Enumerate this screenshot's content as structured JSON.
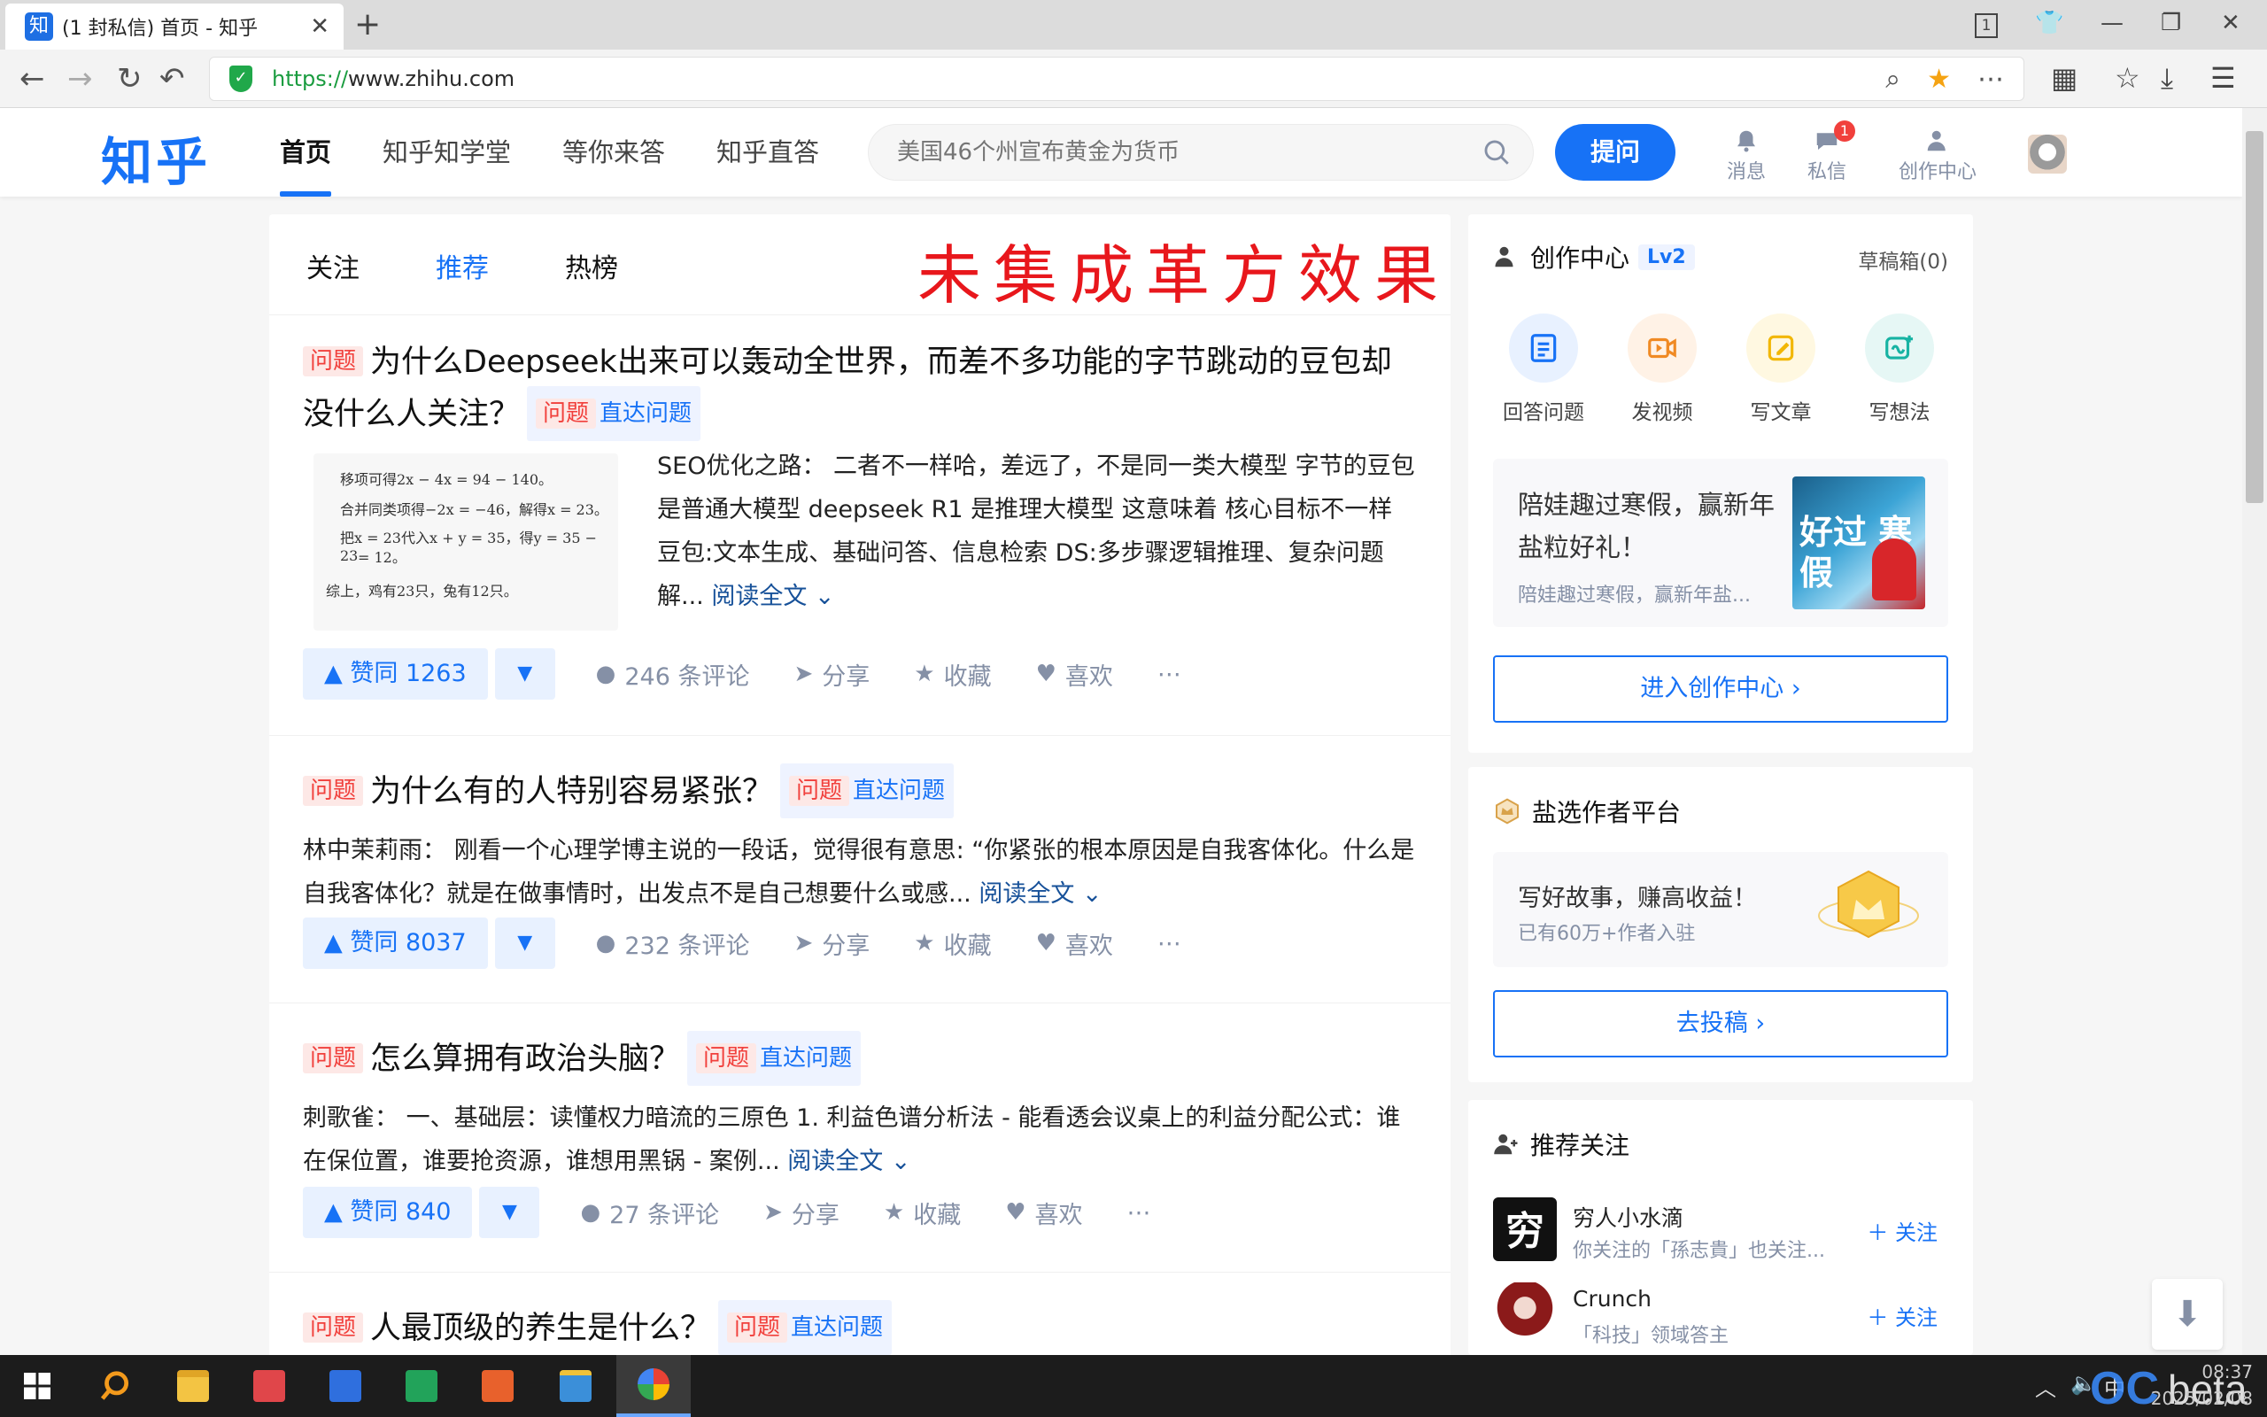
{
  "browser": {
    "tab_title": "(1 封私信) 首页 - 知乎",
    "tab_favicon": "知",
    "url_protocol": "https://",
    "url_rest": "www.zhihu.com",
    "tab_count": "1"
  },
  "header": {
    "logo": "知乎",
    "nav": [
      "首页",
      "知乎知学堂",
      "等你来答",
      "知乎直答"
    ],
    "search_placeholder": "美国46个州宣布黄金为货币",
    "ask_button": "提问",
    "icons": [
      {
        "label": "消息",
        "icon": "bell-icon"
      },
      {
        "label": "私信",
        "icon": "message-icon",
        "badge": "1"
      },
      {
        "label": "创作中心",
        "icon": "creator-icon"
      }
    ]
  },
  "feed": {
    "tabs": [
      "关注",
      "推荐",
      "热榜"
    ],
    "overlay": "未集成革方效果",
    "q_tag": "问题",
    "direct_link": "直达问题",
    "read_more": "阅读全文",
    "share": "分享",
    "collect": "收藏",
    "like": "喜欢",
    "items": [
      {
        "title": "为什么Deepseek出来可以轰动全世界，而差不多功能的字节跳动的豆包却没什么人关注？",
        "excerpt": "SEO优化之路： 二者不一样哈，差远了，不是同一类大模型 字节的豆包是普通大模型 deepseek R1 是推理大模型 这意味着 核心目标不一样 豆包:文本生成、基础问答、信息检索 DS:多步骤逻辑推理、复杂问题解...",
        "votes": "赞同 1263",
        "comments": "246 条评论",
        "thumb_lines": [
          "移项可得2x − 4x = 94 − 140。",
          "合并同类项得−2x = −46，解得x = 23。",
          "把x = 23代入x + y = 35，得y = 35 − 23",
          "= 12。",
          "综上，鸡有23只，兔有12只。"
        ]
      },
      {
        "title": "为什么有的人特别容易紧张？",
        "excerpt": "林中茉莉雨： 刚看一个心理学博主说的一段话，觉得很有意思: “你紧张的根本原因是自我客体化。什么是自我客体化？就是在做事情时，出发点不是自己想要什么或感...",
        "votes": "赞同 8037",
        "comments": "232 条评论"
      },
      {
        "title": "怎么算拥有政治头脑？",
        "excerpt": "刺歌雀： 一、基础层：读懂权力暗流的三原色 1. 利益色谱分析法 - 能看透会议桌上的利益分配公式：谁在保位置，谁要抢资源，谁想用黑锅 - 案例...",
        "votes": "赞同 840",
        "comments": "27 条评论"
      },
      {
        "title": "人最顶级的养生是什么？"
      }
    ]
  },
  "sidebar": {
    "creator": {
      "title": "创作中心",
      "level": "Lv2",
      "drafts": "草稿箱(0)",
      "tools": [
        {
          "label": "回答问题",
          "icon": "answer-icon",
          "color": "#1772f6",
          "bg": "#e8f1ff"
        },
        {
          "label": "发视频",
          "icon": "video-icon",
          "color": "#f08a24",
          "bg": "#fff2e6"
        },
        {
          "label": "写文章",
          "icon": "article-icon",
          "color": "#f2b705",
          "bg": "#fff8e1"
        },
        {
          "label": "写想法",
          "icon": "idea-icon",
          "color": "#17b3a3",
          "bg": "#e6f7f5"
        }
      ],
      "promo_title": "陪娃趣过寒假，赢新年盐粒好礼！",
      "promo_sub": "陪娃趣过寒假，赢新年盐...",
      "promo_img_text": "好过 寒假",
      "enter": "进入创作中心 ›"
    },
    "salt": {
      "title": "盐选作者平台",
      "card_title": "写好故事，赚高收益！",
      "card_sub": "已有60万+作者入驻",
      "submit": "去投稿 ›"
    },
    "recommend": {
      "title": "推荐关注",
      "follow": "关注",
      "users": [
        {
          "name": "穷人小水滴",
          "desc": "你关注的「孫志貴」也关注...",
          "avatar_text": "穷"
        },
        {
          "name": "Crunch",
          "desc": "「科技」领域答主"
        }
      ]
    }
  },
  "taskbar": {
    "time": "08:37",
    "date": "2025/02/08",
    "ime": "中",
    "beta": "beta",
    "oc": "OC"
  }
}
